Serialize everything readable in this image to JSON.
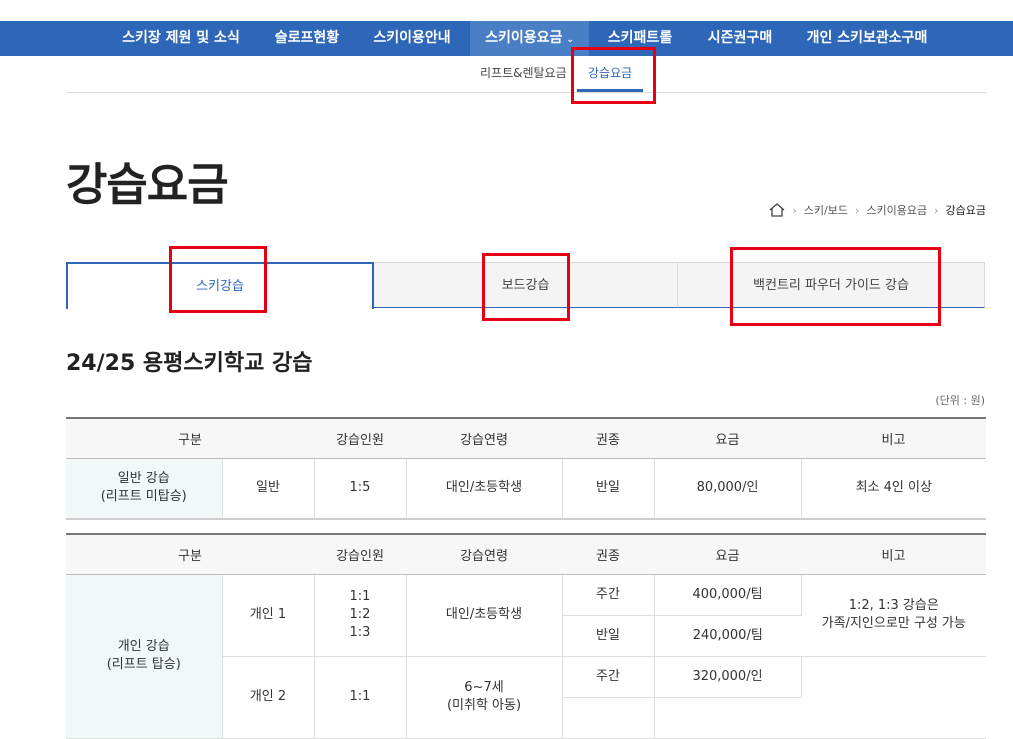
{
  "topnav": {
    "items": [
      {
        "label": "스키장 제원 및 소식"
      },
      {
        "label": "슬로프현황"
      },
      {
        "label": "스키이용안내"
      },
      {
        "label": "스키이용요금",
        "caret": "⌄"
      },
      {
        "label": "스키패트롤"
      },
      {
        "label": "시즌권구매"
      },
      {
        "label": "개인 스키보관소구매"
      }
    ]
  },
  "subnav": {
    "items": [
      {
        "label": "리프트&렌탈요금"
      },
      {
        "label": "강습요금"
      }
    ]
  },
  "page": {
    "title": "강습요금",
    "breadcrumb": [
      "스키/보드",
      "스키이용요금",
      "강습요금"
    ]
  },
  "tabs": [
    {
      "label": "스키강습"
    },
    {
      "label": "보드강습"
    },
    {
      "label": "백컨트리 파우더 가이드 강습"
    }
  ],
  "section": {
    "title": "24/25 용평스키학교 강습",
    "unit": "(단위 : 원)"
  },
  "table_headers": [
    "구분",
    "강습인원",
    "강습연령",
    "권종",
    "요금",
    "비고"
  ],
  "table1": {
    "category": [
      "일반 강습",
      "(리프트 미탑승)"
    ],
    "sub": "일반",
    "people": "1:5",
    "age": "대인/초등학생",
    "ticket": "반일",
    "price": "80,000/인",
    "note": "최소 4인 이상"
  },
  "table2": {
    "category": [
      "개인 강습",
      "(리프트 탑승)"
    ],
    "rows": [
      {
        "sub": "개인 1",
        "people": [
          "1:1",
          "1:2",
          "1:3"
        ],
        "age": "대인/초등학생",
        "ticket1": "주간",
        "price1": "400,000/팀",
        "ticket2": "반일",
        "price2": "240,000/팀",
        "note": [
          "1:2, 1:3 강습은",
          "가족/지인으로만 구성 가능"
        ]
      },
      {
        "sub": "개인 2",
        "people": "1:1",
        "age": [
          "6~7세",
          "(미취학 아동)"
        ],
        "ticket1": "주간",
        "price1": "320,000/인"
      }
    ]
  }
}
